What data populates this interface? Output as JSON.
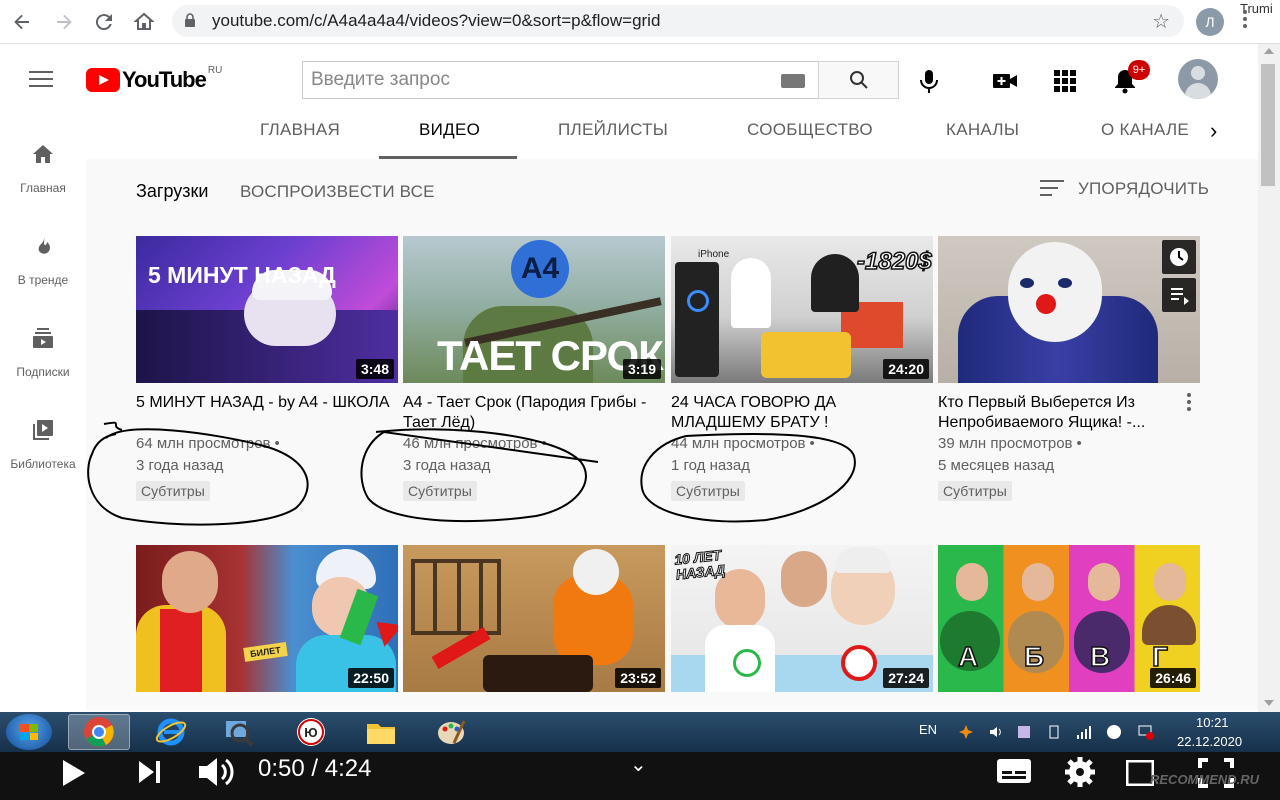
{
  "browser": {
    "url": "youtube.com/c/A4a4a4a4/videos?view=0&sort=p&flow=grid",
    "profile_initial": "Л",
    "window_user": "Trumi"
  },
  "youtube": {
    "region": "RU",
    "search_placeholder": "Введите запрос",
    "notifications_count": "9+",
    "guide": [
      {
        "label": "Главная",
        "icon": "home-icon"
      },
      {
        "label": "В тренде",
        "icon": "trending-icon"
      },
      {
        "label": "Подписки",
        "icon": "subscriptions-icon"
      },
      {
        "label": "Библиотека",
        "icon": "library-icon"
      }
    ],
    "tabs": [
      "ГЛАВНАЯ",
      "ВИДЕО",
      "ПЛЕЙЛИСТЫ",
      "СООБЩЕСТВО",
      "КАНАЛЫ",
      "О КАНАЛЕ"
    ],
    "active_tab": "ВИДЕО",
    "section_title": "Загрузки",
    "play_all": "ВОСПРОИЗВЕСТИ ВСЕ",
    "sort_label": "УПОРЯДОЧИТЬ",
    "videos": [
      {
        "title": "5 МИНУТ НАЗАД - by A4 - ШКОЛА",
        "views": "64 млн просмотров",
        "age": "3 года назад",
        "badge": "Субтитры",
        "duration": "3:48",
        "thumb_text": "5 МИНУТ НАЗАД"
      },
      {
        "title": "A4 - Тает Срок (Пародия Грибы - Тает Лёд)",
        "views": "46 млн просмотров",
        "age": "3 года назад",
        "badge": "Субтитры",
        "duration": "3:19",
        "thumb_text": "ТАЕТ СРОК",
        "thumb_logo": "A4"
      },
      {
        "title": "24 ЧАСА ГОВОРЮ ДА МЛАДШЕМУ БРАТУ !",
        "views": "44 млн просмотров",
        "age": "1 год назад",
        "badge": "Субтитры",
        "duration": "24:20",
        "thumb_text": "-1820$",
        "thumb_small": "iPhone"
      },
      {
        "title": "Кто Первый Выберется Из Непробиваемого Ящика! -...",
        "views": "39 млн просмотров",
        "age": "5 месяцев назад",
        "badge": "Субтитры",
        "duration": ""
      },
      {
        "duration": "22:50",
        "thumb_small": "БИЛЕТ"
      },
      {
        "duration": "23:52"
      },
      {
        "duration": "27:24",
        "thumb_text": "10 ЛЕТ НАЗАД"
      },
      {
        "duration": "26:46",
        "letters": [
          "А",
          "Б",
          "В",
          "Г"
        ]
      }
    ]
  },
  "taskbar": {
    "lang": "EN",
    "time": "10:21",
    "date": "22.12.2020"
  },
  "player": {
    "time": "0:50 / 4:24"
  },
  "watermark": "RECOMMEND.RU"
}
